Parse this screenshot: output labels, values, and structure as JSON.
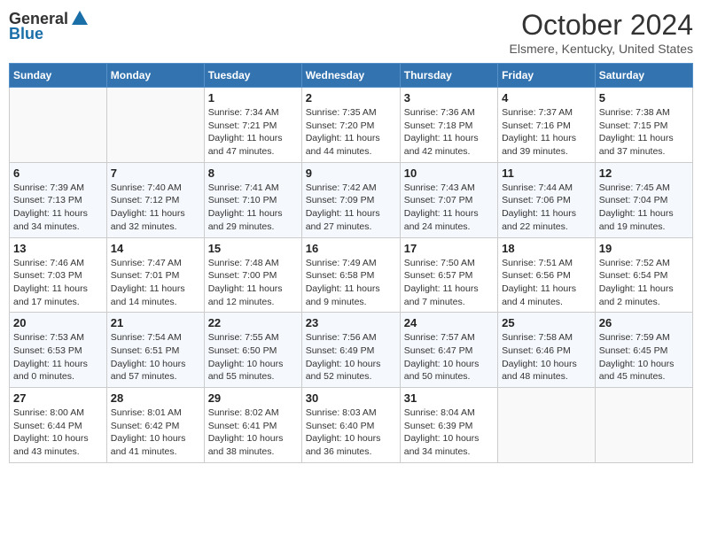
{
  "header": {
    "logo_general": "General",
    "logo_blue": "Blue",
    "month_title": "October 2024",
    "location": "Elsmere, Kentucky, United States"
  },
  "days_of_week": [
    "Sunday",
    "Monday",
    "Tuesday",
    "Wednesday",
    "Thursday",
    "Friday",
    "Saturday"
  ],
  "weeks": [
    [
      {
        "day": "",
        "sunrise": "",
        "sunset": "",
        "daylight": ""
      },
      {
        "day": "",
        "sunrise": "",
        "sunset": "",
        "daylight": ""
      },
      {
        "day": "1",
        "sunrise": "Sunrise: 7:34 AM",
        "sunset": "Sunset: 7:21 PM",
        "daylight": "Daylight: 11 hours and 47 minutes."
      },
      {
        "day": "2",
        "sunrise": "Sunrise: 7:35 AM",
        "sunset": "Sunset: 7:20 PM",
        "daylight": "Daylight: 11 hours and 44 minutes."
      },
      {
        "day": "3",
        "sunrise": "Sunrise: 7:36 AM",
        "sunset": "Sunset: 7:18 PM",
        "daylight": "Daylight: 11 hours and 42 minutes."
      },
      {
        "day": "4",
        "sunrise": "Sunrise: 7:37 AM",
        "sunset": "Sunset: 7:16 PM",
        "daylight": "Daylight: 11 hours and 39 minutes."
      },
      {
        "day": "5",
        "sunrise": "Sunrise: 7:38 AM",
        "sunset": "Sunset: 7:15 PM",
        "daylight": "Daylight: 11 hours and 37 minutes."
      }
    ],
    [
      {
        "day": "6",
        "sunrise": "Sunrise: 7:39 AM",
        "sunset": "Sunset: 7:13 PM",
        "daylight": "Daylight: 11 hours and 34 minutes."
      },
      {
        "day": "7",
        "sunrise": "Sunrise: 7:40 AM",
        "sunset": "Sunset: 7:12 PM",
        "daylight": "Daylight: 11 hours and 32 minutes."
      },
      {
        "day": "8",
        "sunrise": "Sunrise: 7:41 AM",
        "sunset": "Sunset: 7:10 PM",
        "daylight": "Daylight: 11 hours and 29 minutes."
      },
      {
        "day": "9",
        "sunrise": "Sunrise: 7:42 AM",
        "sunset": "Sunset: 7:09 PM",
        "daylight": "Daylight: 11 hours and 27 minutes."
      },
      {
        "day": "10",
        "sunrise": "Sunrise: 7:43 AM",
        "sunset": "Sunset: 7:07 PM",
        "daylight": "Daylight: 11 hours and 24 minutes."
      },
      {
        "day": "11",
        "sunrise": "Sunrise: 7:44 AM",
        "sunset": "Sunset: 7:06 PM",
        "daylight": "Daylight: 11 hours and 22 minutes."
      },
      {
        "day": "12",
        "sunrise": "Sunrise: 7:45 AM",
        "sunset": "Sunset: 7:04 PM",
        "daylight": "Daylight: 11 hours and 19 minutes."
      }
    ],
    [
      {
        "day": "13",
        "sunrise": "Sunrise: 7:46 AM",
        "sunset": "Sunset: 7:03 PM",
        "daylight": "Daylight: 11 hours and 17 minutes."
      },
      {
        "day": "14",
        "sunrise": "Sunrise: 7:47 AM",
        "sunset": "Sunset: 7:01 PM",
        "daylight": "Daylight: 11 hours and 14 minutes."
      },
      {
        "day": "15",
        "sunrise": "Sunrise: 7:48 AM",
        "sunset": "Sunset: 7:00 PM",
        "daylight": "Daylight: 11 hours and 12 minutes."
      },
      {
        "day": "16",
        "sunrise": "Sunrise: 7:49 AM",
        "sunset": "Sunset: 6:58 PM",
        "daylight": "Daylight: 11 hours and 9 minutes."
      },
      {
        "day": "17",
        "sunrise": "Sunrise: 7:50 AM",
        "sunset": "Sunset: 6:57 PM",
        "daylight": "Daylight: 11 hours and 7 minutes."
      },
      {
        "day": "18",
        "sunrise": "Sunrise: 7:51 AM",
        "sunset": "Sunset: 6:56 PM",
        "daylight": "Daylight: 11 hours and 4 minutes."
      },
      {
        "day": "19",
        "sunrise": "Sunrise: 7:52 AM",
        "sunset": "Sunset: 6:54 PM",
        "daylight": "Daylight: 11 hours and 2 minutes."
      }
    ],
    [
      {
        "day": "20",
        "sunrise": "Sunrise: 7:53 AM",
        "sunset": "Sunset: 6:53 PM",
        "daylight": "Daylight: 11 hours and 0 minutes."
      },
      {
        "day": "21",
        "sunrise": "Sunrise: 7:54 AM",
        "sunset": "Sunset: 6:51 PM",
        "daylight": "Daylight: 10 hours and 57 minutes."
      },
      {
        "day": "22",
        "sunrise": "Sunrise: 7:55 AM",
        "sunset": "Sunset: 6:50 PM",
        "daylight": "Daylight: 10 hours and 55 minutes."
      },
      {
        "day": "23",
        "sunrise": "Sunrise: 7:56 AM",
        "sunset": "Sunset: 6:49 PM",
        "daylight": "Daylight: 10 hours and 52 minutes."
      },
      {
        "day": "24",
        "sunrise": "Sunrise: 7:57 AM",
        "sunset": "Sunset: 6:47 PM",
        "daylight": "Daylight: 10 hours and 50 minutes."
      },
      {
        "day": "25",
        "sunrise": "Sunrise: 7:58 AM",
        "sunset": "Sunset: 6:46 PM",
        "daylight": "Daylight: 10 hours and 48 minutes."
      },
      {
        "day": "26",
        "sunrise": "Sunrise: 7:59 AM",
        "sunset": "Sunset: 6:45 PM",
        "daylight": "Daylight: 10 hours and 45 minutes."
      }
    ],
    [
      {
        "day": "27",
        "sunrise": "Sunrise: 8:00 AM",
        "sunset": "Sunset: 6:44 PM",
        "daylight": "Daylight: 10 hours and 43 minutes."
      },
      {
        "day": "28",
        "sunrise": "Sunrise: 8:01 AM",
        "sunset": "Sunset: 6:42 PM",
        "daylight": "Daylight: 10 hours and 41 minutes."
      },
      {
        "day": "29",
        "sunrise": "Sunrise: 8:02 AM",
        "sunset": "Sunset: 6:41 PM",
        "daylight": "Daylight: 10 hours and 38 minutes."
      },
      {
        "day": "30",
        "sunrise": "Sunrise: 8:03 AM",
        "sunset": "Sunset: 6:40 PM",
        "daylight": "Daylight: 10 hours and 36 minutes."
      },
      {
        "day": "31",
        "sunrise": "Sunrise: 8:04 AM",
        "sunset": "Sunset: 6:39 PM",
        "daylight": "Daylight: 10 hours and 34 minutes."
      },
      {
        "day": "",
        "sunrise": "",
        "sunset": "",
        "daylight": ""
      },
      {
        "day": "",
        "sunrise": "",
        "sunset": "",
        "daylight": ""
      }
    ]
  ]
}
